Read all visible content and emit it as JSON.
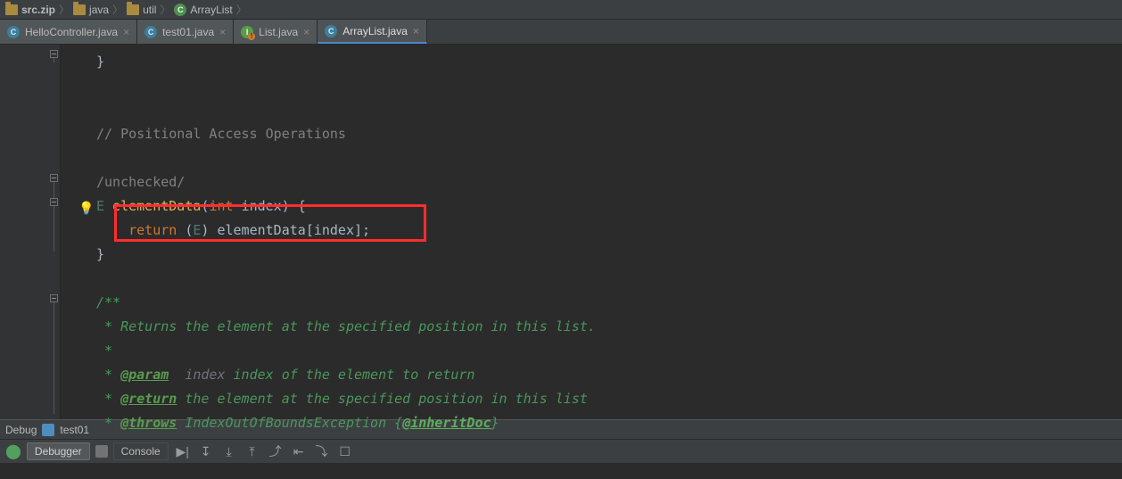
{
  "breadcrumb": [
    {
      "label": "src.zip",
      "icon": "zip"
    },
    {
      "label": "java",
      "icon": "folder"
    },
    {
      "label": "util",
      "icon": "folder"
    },
    {
      "label": "ArrayList",
      "icon": "class"
    }
  ],
  "tabs": [
    {
      "label": "HelloController.java",
      "icon": "java",
      "active": false
    },
    {
      "label": "test01.java",
      "icon": "java",
      "active": false
    },
    {
      "label": "List.java",
      "icon": "interface",
      "active": false
    },
    {
      "label": "ArrayList.java",
      "icon": "java",
      "active": true
    }
  ],
  "code": {
    "lines": [
      {
        "tokens": [
          {
            "t": "punc",
            "s": "}"
          }
        ]
      },
      {
        "tokens": []
      },
      {
        "tokens": []
      },
      {
        "tokens": [
          {
            "t": "comment",
            "s": "// Positional Access Operations"
          }
        ]
      },
      {
        "tokens": []
      },
      {
        "tokens": [
          {
            "t": "comment",
            "s": "/unchecked/"
          }
        ]
      },
      {
        "tokens": [
          {
            "t": "type",
            "s": "E "
          },
          {
            "t": "func",
            "s": "elementData"
          },
          {
            "t": "punc",
            "s": "("
          },
          {
            "t": "kw",
            "s": "int "
          },
          {
            "t": "plain",
            "s": "index"
          },
          {
            "t": "punc",
            "s": ") {"
          }
        ],
        "bulb": true
      },
      {
        "tokens": [
          {
            "t": "plain",
            "s": "    "
          },
          {
            "t": "kw",
            "s": "return "
          },
          {
            "t": "punc",
            "s": "("
          },
          {
            "t": "type",
            "s": "E"
          },
          {
            "t": "punc",
            "s": ") "
          },
          {
            "t": "plain",
            "s": "elementData"
          },
          {
            "t": "punc",
            "s": "["
          },
          {
            "t": "plain",
            "s": "index"
          },
          {
            "t": "punc",
            "s": "];"
          }
        ],
        "highlighted": true
      },
      {
        "tokens": [
          {
            "t": "punc",
            "s": "}"
          }
        ]
      },
      {
        "tokens": []
      },
      {
        "tokens": [
          {
            "t": "docc",
            "s": "/**"
          }
        ]
      },
      {
        "tokens": [
          {
            "t": "docc",
            "s": " * Returns the element at the specified position in this list."
          }
        ]
      },
      {
        "tokens": [
          {
            "t": "docc",
            "s": " *"
          }
        ]
      },
      {
        "tokens": [
          {
            "t": "docc",
            "s": " * "
          },
          {
            "t": "doctag",
            "s": "@param"
          },
          {
            "t": "param",
            "s": "  index "
          },
          {
            "t": "docc",
            "s": "index of the element to return"
          }
        ]
      },
      {
        "tokens": [
          {
            "t": "docc",
            "s": " * "
          },
          {
            "t": "doctag",
            "s": "@return"
          },
          {
            "t": "docc",
            "s": " the element at the specified position in this list"
          }
        ]
      },
      {
        "tokens": [
          {
            "t": "docc",
            "s": " * "
          },
          {
            "t": "doctag",
            "s": "@throws"
          },
          {
            "t": "docc",
            "s": " IndexOutOfBoundsException {"
          },
          {
            "t": "docref",
            "s": "@inheritDoc"
          },
          {
            "t": "docc",
            "s": "}"
          }
        ]
      }
    ]
  },
  "debug": {
    "label": "Debug",
    "config": "test01"
  },
  "bottom": {
    "debugger": "Debugger",
    "console": "Console",
    "icons": [
      "▶|",
      "↧",
      "⤓",
      "⤒",
      "⤴",
      "⇤",
      "⤵",
      "☐"
    ]
  }
}
